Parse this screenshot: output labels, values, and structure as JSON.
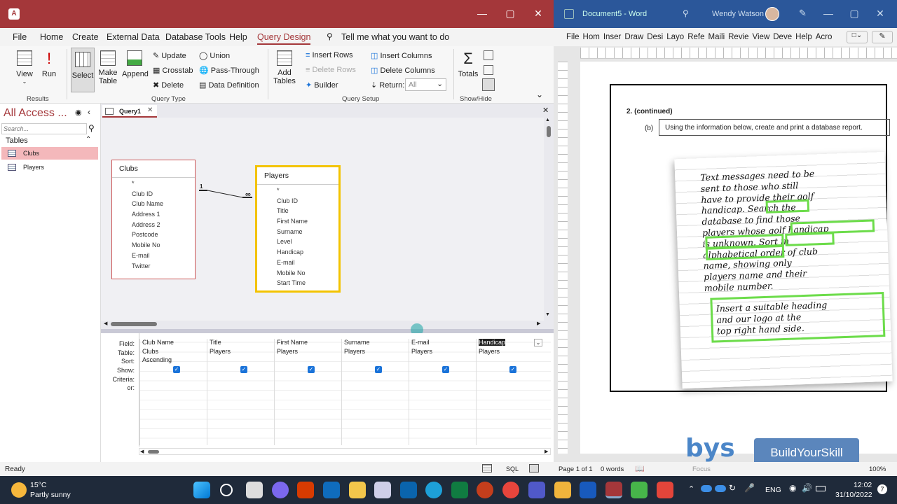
{
  "access": {
    "tabs": [
      "File",
      "Home",
      "Create",
      "External Data",
      "Database Tools",
      "Help",
      "Query Design"
    ],
    "tell_me": "Tell me what you want to do",
    "ribbon": {
      "results": {
        "view": "View",
        "run": "Run",
        "label": "Results"
      },
      "query_type": {
        "select": "Select",
        "make_table": "Make Table",
        "append": "Append",
        "update": "Update",
        "crosstab": "Crosstab",
        "delete": "Delete",
        "union": "Union",
        "pass_through": "Pass-Through",
        "data_definition": "Data Definition",
        "label": "Query Type"
      },
      "query_setup": {
        "show_table": "Add Tables",
        "insert_rows": "Insert Rows",
        "delete_rows": "Delete Rows",
        "builder": "Builder",
        "insert_columns": "Insert Columns",
        "delete_columns": "Delete Columns",
        "return_label": "Return:",
        "return_value": "All",
        "label": "Query Setup"
      },
      "show_hide": {
        "totals": "Totals",
        "label": "Show/Hide"
      }
    },
    "nav": {
      "title": "All Access ...",
      "search_placeholder": "Search...",
      "section": "Tables",
      "items": [
        "Clubs",
        "Players"
      ]
    },
    "query_tab": "Query1",
    "clubs_table": {
      "title": "Clubs",
      "fields": [
        "*",
        "Club ID",
        "Club Name",
        "Address 1",
        "Address 2",
        "Postcode",
        "Mobile No",
        "E-mail",
        "Twitter"
      ]
    },
    "players_table": {
      "title": "Players",
      "fields": [
        "*",
        "Club ID",
        "Title",
        "First Name",
        "Surname",
        "Level",
        "Handicap",
        "E-mail",
        "Mobile No",
        "Start Time"
      ]
    },
    "relationship": {
      "one": "1",
      "many": "∞"
    },
    "grid": {
      "row_labels": [
        "Field:",
        "Table:",
        "Sort:",
        "Show:",
        "Criteria:",
        "or:"
      ],
      "columns": [
        {
          "field": "Club Name",
          "table": "Clubs",
          "sort": "Ascending"
        },
        {
          "field": "Title",
          "table": "Players",
          "sort": ""
        },
        {
          "field": "First Name",
          "table": "Players",
          "sort": ""
        },
        {
          "field": "Surname",
          "table": "Players",
          "sort": ""
        },
        {
          "field": "E-mail",
          "table": "Players",
          "sort": ""
        },
        {
          "field": "Handicap",
          "table": "Players",
          "sort": ""
        }
      ]
    },
    "status": "Ready",
    "sql_label": "SQL"
  },
  "word": {
    "title": "Document5 - Word",
    "user": "Wendy Watson",
    "tabs": [
      "File",
      "Hom",
      "Inser",
      "Draw",
      "Desi",
      "Layo",
      "Refe",
      "Maili",
      "Revie",
      "View",
      "Deve",
      "Help",
      "Acro"
    ],
    "question_num": "2. (continued)",
    "part": "(b)",
    "instruction": "Using the information below, create and print a database report.",
    "note_lines": [
      "Text messages need to be",
      "sent to those who still",
      "have to provide their golf",
      "handicap. Search the",
      "database to find those",
      "players whose golf handicap",
      "is unknown. Sort in",
      "alphabetical order of club",
      "name, showing only",
      "players name and their",
      "mobile number."
    ],
    "note2_lines": [
      "Insert a suitable heading",
      "and our logo at the",
      "top right hand side."
    ],
    "status_page": "Page 1 of 1",
    "status_words": "0 words",
    "focus": "Focus",
    "zoom": "100%",
    "logo_short": "bys",
    "logo_text": "BuildYourSkill"
  },
  "taskbar": {
    "temp": "15°C",
    "weather": "Partly sunny",
    "lang": "ENG",
    "time": "12:02",
    "date": "31/10/2022",
    "badge": "7"
  }
}
